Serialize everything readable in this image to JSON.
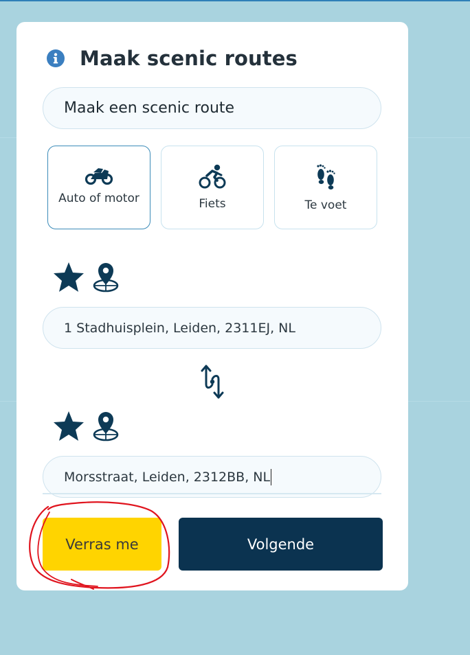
{
  "panel": {
    "title": "Maak scenic routes"
  },
  "route_name": {
    "value": "Maak een scenic route"
  },
  "modes": [
    {
      "label": "Auto of motor",
      "icon": "motorcycle-icon",
      "selected": true
    },
    {
      "label": "Fiets",
      "icon": "cyclist-icon",
      "selected": false
    },
    {
      "label": "Te voet",
      "icon": "footprints-icon",
      "selected": false
    }
  ],
  "start": {
    "value": "1 Stadhuisplein, Leiden, 2311EJ, NL"
  },
  "end": {
    "value": "Morsstraat, Leiden, 2312BB, NL"
  },
  "buttons": {
    "surprise": "Verras me",
    "next": "Volgende"
  },
  "colors": {
    "background": "#a9d3df",
    "accent_dark": "#0b3350",
    "accent_yellow": "#ffd400",
    "annotation_red": "#e0141e"
  }
}
